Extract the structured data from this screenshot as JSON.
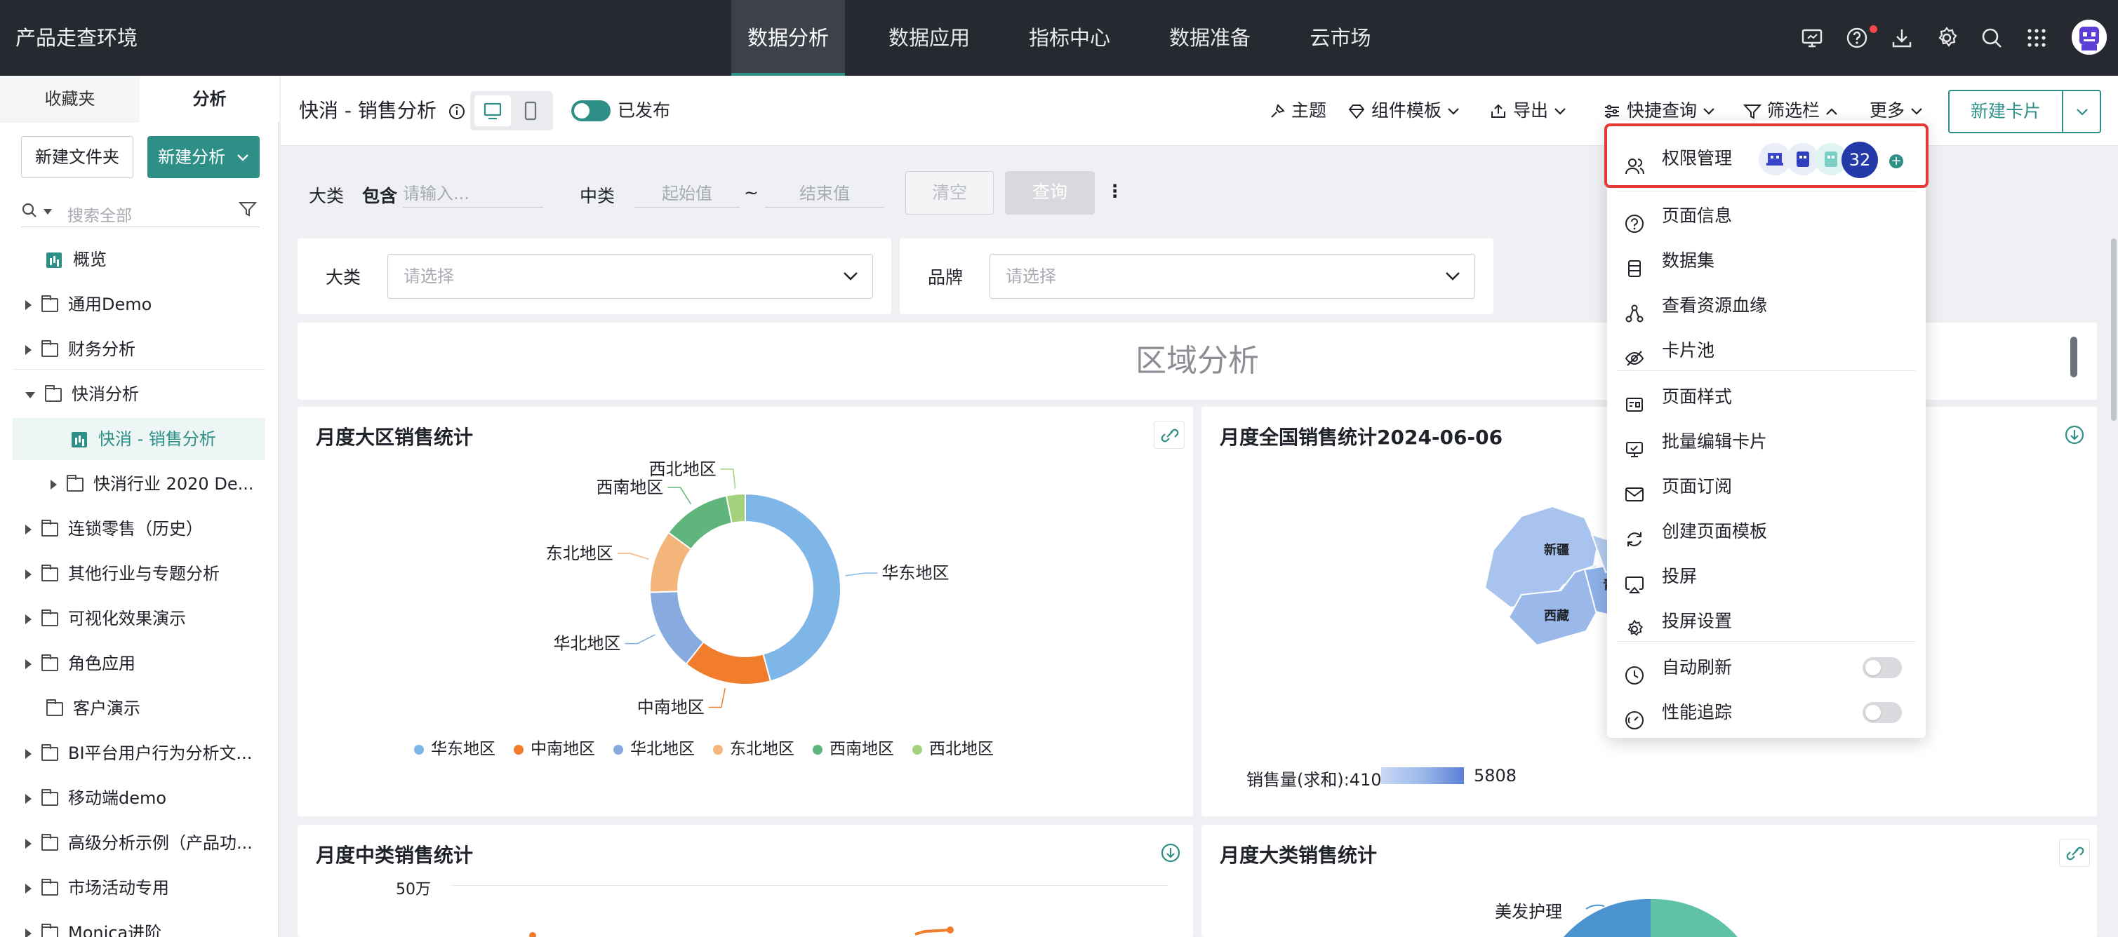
{
  "app_title": "产品走查环境",
  "nav_tabs": [
    {
      "label": "数据分析",
      "active": true
    },
    {
      "label": "数据应用",
      "active": false
    },
    {
      "label": "指标中心",
      "active": false
    },
    {
      "label": "数据准备",
      "active": false
    },
    {
      "label": "云市场",
      "active": false
    }
  ],
  "top_icons": [
    "monitor-icon",
    "help-icon",
    "download-icon",
    "settings-icon",
    "search-icon",
    "apps-grid-icon",
    "user-avatar"
  ],
  "sidebar": {
    "tabs": [
      {
        "label": "收藏夹",
        "active": false
      },
      {
        "label": "分析",
        "active": true
      }
    ],
    "new_folder": "新建文件夹",
    "new_analysis": "新建分析",
    "search_placeholder": "搜索全部",
    "items": [
      {
        "label": "概览",
        "type": "page",
        "depth": 0
      },
      {
        "label": "通用Demo",
        "type": "folder",
        "depth": 0,
        "expanded": false
      },
      {
        "label": "财务分析",
        "type": "folder",
        "depth": 0,
        "expanded": false
      },
      {
        "label": "快消分析",
        "type": "folder",
        "depth": 0,
        "expanded": true
      },
      {
        "label": "快消 - 销售分析",
        "type": "page",
        "depth": 1,
        "selected": true
      },
      {
        "label": "快消行业 2020 De...",
        "type": "folder",
        "depth": 1,
        "expanded": false
      },
      {
        "label": "连锁零售（历史）",
        "type": "folder",
        "depth": 0,
        "expanded": false
      },
      {
        "label": "其他行业与专题分析",
        "type": "folder",
        "depth": 0,
        "expanded": false
      },
      {
        "label": "可视化效果演示",
        "type": "folder",
        "depth": 0,
        "expanded": false
      },
      {
        "label": "角色应用",
        "type": "folder",
        "depth": 0,
        "expanded": false
      },
      {
        "label": "客户演示",
        "type": "folder",
        "depth": 0,
        "expanded": null
      },
      {
        "label": "BI平台用户行为分析文...",
        "type": "folder",
        "depth": 0,
        "expanded": false
      },
      {
        "label": "移动端demo",
        "type": "folder",
        "depth": 0,
        "expanded": false
      },
      {
        "label": "高级分析示例（产品功...",
        "type": "folder",
        "depth": 0,
        "expanded": false
      },
      {
        "label": "市场活动专用",
        "type": "folder",
        "depth": 0,
        "expanded": false
      },
      {
        "label": "Monica进阶",
        "type": "folder",
        "depth": 0,
        "expanded": false
      }
    ]
  },
  "page": {
    "title": "快消 - 销售分析",
    "published_label": "已发布",
    "published": true,
    "toolbar": {
      "theme": "主题",
      "component_template": "组件模板",
      "export": "导出",
      "quick_query": "快捷查询",
      "filter_bar": "筛选栏",
      "more": "更多",
      "new_card": "新建卡片"
    }
  },
  "filters": {
    "category_label": "大类",
    "category_op": "包含",
    "category_placeholder": "请输入...",
    "mid_label": "中类",
    "start_placeholder": "起始值",
    "range_sep": "~",
    "end_placeholder": "结束值",
    "clear": "清空",
    "query": "查询"
  },
  "selectors": [
    {
      "label": "大类",
      "placeholder": "请选择"
    },
    {
      "label": "品牌",
      "placeholder": "请选择"
    }
  ],
  "section_title": "区域分析",
  "cards": {
    "region_month": "月度大区销售统计",
    "national_month": "月度全国销售统计2024-06-06",
    "mid_month": "月度中类销售统计",
    "category_month": "月度大类销售统计"
  },
  "chart_data": [
    {
      "type": "pie",
      "title": "月度大区销售统计",
      "categories": [
        "华东地区",
        "中南地区",
        "华北地区",
        "东北地区",
        "西南地区",
        "西北地区"
      ],
      "values": [
        43,
        14,
        13,
        10,
        11,
        3
      ],
      "colors": [
        "#7fb6e8",
        "#f07c2c",
        "#87abde",
        "#f3b57a",
        "#5fb57c",
        "#a3d17e"
      ],
      "legend": "bottom"
    },
    {
      "type": "heatmap",
      "title": "月度全国销售统计2024-06-06",
      "map_labels": [
        "新疆",
        "西藏",
        "青"
      ],
      "visual_map_label": "销售量(求和):410",
      "min": 410,
      "max": 5808
    },
    {
      "type": "line",
      "title": "月度中类销售统计",
      "y_tick_labels": [
        "50万"
      ]
    },
    {
      "type": "pie",
      "title": "月度大类销售统计",
      "categories": [
        "美发护理"
      ]
    }
  ],
  "more_menu": {
    "permission": {
      "label": "权限管理",
      "member_count": "32"
    },
    "items": [
      {
        "label": "页面信息",
        "icon": "info-circle-icon"
      },
      {
        "label": "数据集",
        "icon": "database-icon"
      },
      {
        "label": "查看资源血缘",
        "icon": "lineage-icon"
      },
      {
        "label": "卡片池",
        "icon": "eye-off-icon"
      },
      {
        "label": "页面样式",
        "icon": "page-style-icon"
      },
      {
        "label": "批量编辑卡片",
        "icon": "batch-edit-icon"
      },
      {
        "label": "页面订阅",
        "icon": "mail-icon"
      },
      {
        "label": "创建页面模板",
        "icon": "refresh-template-icon"
      },
      {
        "label": "投屏",
        "icon": "cast-icon"
      },
      {
        "label": "投屏设置",
        "icon": "gear-icon"
      }
    ],
    "toggles": [
      {
        "label": "自动刷新",
        "on": false
      },
      {
        "label": "性能追踪",
        "on": false
      }
    ]
  },
  "colors": {
    "brand": "#2e8f86",
    "nav_bg": "#26292f",
    "highlight": "#e53935"
  }
}
